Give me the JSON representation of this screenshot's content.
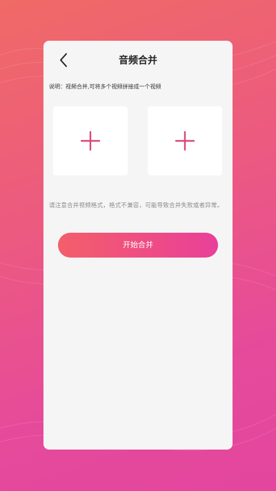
{
  "header": {
    "title": "音频合并",
    "back_icon": "chevron-left-icon"
  },
  "description": "说明：视频合并,可将多个视频拼接成一个视频",
  "upload_slots": [
    {
      "icon": "plus-icon"
    },
    {
      "icon": "plus-icon"
    }
  ],
  "notice": "请注意合并视频格式，格式不兼容，可能导致合并失败或者异常。",
  "start_button": {
    "label": "开始合并"
  },
  "colors": {
    "accent": "#d8487a",
    "button_start": "#f35f6a",
    "button_end": "#e8409a",
    "background_top": "#f06a66",
    "background_bottom": "#e3469e"
  }
}
